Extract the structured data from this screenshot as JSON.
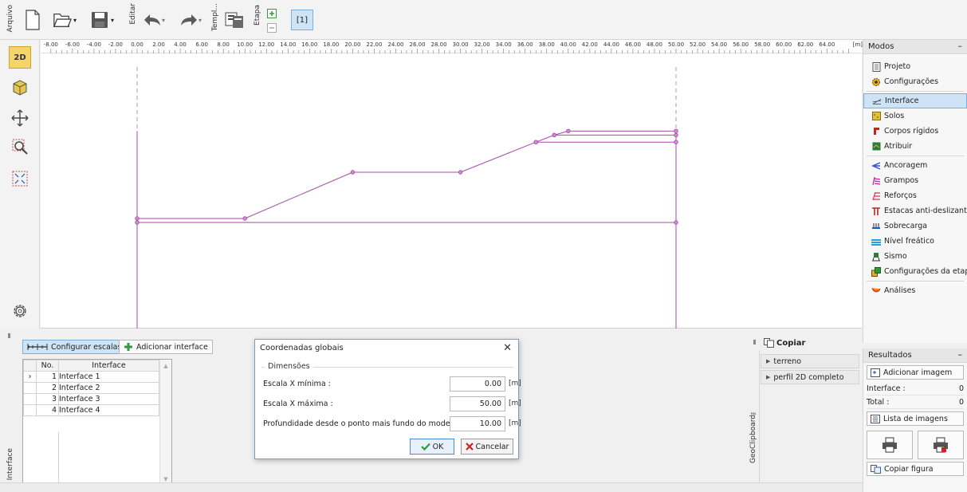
{
  "toolbar": {
    "arquivo_label": "Arquivo",
    "editar_label": "Editar",
    "templ_label": "Templ...",
    "etapa_label": "Etapa",
    "stage_label": "[1]"
  },
  "left_tools": {
    "mode_2d": "2D",
    "mode_3d": "3D"
  },
  "ruler": {
    "ticks": [
      "-8.00",
      "-6.00",
      "-4.00",
      "-2.00",
      "0.00",
      "2.00",
      "4.00",
      "6.00",
      "8.00",
      "10.00",
      "12.00",
      "14.00",
      "16.00",
      "18.00",
      "20.00",
      "22.00",
      "24.00",
      "26.00",
      "28.00",
      "30.00",
      "32.00",
      "34.00",
      "36.00",
      "38.00",
      "40.00",
      "42.00",
      "44.00",
      "46.00",
      "48.00",
      "50.00",
      "52.00",
      "54.00",
      "56.00",
      "58.00",
      "60.00",
      "62.00",
      "64.00"
    ],
    "unit": "[m]"
  },
  "model": {
    "line_color": "#a44aa8",
    "interfaces": [
      [
        [
          0,
          0
        ],
        [
          50,
          0
        ]
      ],
      [
        [
          0,
          0.4
        ],
        [
          10,
          0.4
        ],
        [
          20,
          5
        ],
        [
          30,
          5
        ],
        [
          37,
          8
        ],
        [
          38.7,
          8.7
        ],
        [
          40,
          9.1
        ],
        [
          50,
          9.1
        ]
      ],
      [
        [
          37,
          8
        ],
        [
          50,
          8
        ]
      ],
      [
        [
          38.7,
          8.7
        ],
        [
          50,
          8.7
        ]
      ]
    ]
  },
  "modos": {
    "title": "Modos",
    "items": [
      {
        "label": "Projeto",
        "icon": "document-icon"
      },
      {
        "label": "Configurações",
        "icon": "gear-icon"
      },
      {
        "label": "Interface",
        "icon": "interface-icon",
        "active": true
      },
      {
        "label": "Solos",
        "icon": "soil-icon"
      },
      {
        "label": "Corpos rígidos",
        "icon": "rigid-body-icon"
      },
      {
        "label": "Atribuir",
        "icon": "assign-icon"
      },
      {
        "label": "Ancoragem",
        "icon": "anchor-icon"
      },
      {
        "label": "Grampos",
        "icon": "nail-icon"
      },
      {
        "label": "Reforços",
        "icon": "reinforcement-icon"
      },
      {
        "label": "Estacas anti-deslizantes",
        "icon": "pile-icon"
      },
      {
        "label": "Sobrecarga",
        "icon": "surcharge-icon"
      },
      {
        "label": "Nível freático",
        "icon": "water-table-icon"
      },
      {
        "label": "Sismo",
        "icon": "earthquake-icon"
      },
      {
        "label": "Configurações da etapa",
        "icon": "stage-settings-icon"
      },
      {
        "label": "Análises",
        "icon": "analysis-icon"
      }
    ]
  },
  "results": {
    "title": "Resultados",
    "add_image": "Adicionar imagem",
    "interface_label": "Interface :",
    "interface_value": "0",
    "total_label": "Total :",
    "total_value": "0",
    "image_list": "Lista de imagens",
    "copy_figure": "Copiar figura"
  },
  "interface_panel": {
    "side_label": "Interface",
    "configure_scales": "Configurar escalas",
    "add_interface": "Adicionar interface",
    "columns": [
      "No.",
      "Interface"
    ],
    "rows": [
      {
        "no": "1",
        "name": "Interface 1"
      },
      {
        "no": "2",
        "name": "Interface 2"
      },
      {
        "no": "3",
        "name": "Interface 3"
      },
      {
        "no": "4",
        "name": "Interface 4"
      }
    ]
  },
  "dialog": {
    "title": "Coordenadas globais",
    "group": "Dimensões",
    "fields": [
      {
        "label": "Escala X mínima :",
        "value": "0.00",
        "unit": "[m]"
      },
      {
        "label": "Escala X máxima :",
        "value": "50.00",
        "unit": "[m]"
      },
      {
        "label": "Profundidade desde o ponto mais fundo do modelo :",
        "value": "10.00",
        "unit": "[m]"
      }
    ],
    "ok": "OK",
    "cancel": "Cancelar"
  },
  "geoclipboard": {
    "side_label": "GeoClipboard™",
    "copy": "Copiar",
    "items": [
      "terreno",
      "perfil 2D completo"
    ]
  }
}
